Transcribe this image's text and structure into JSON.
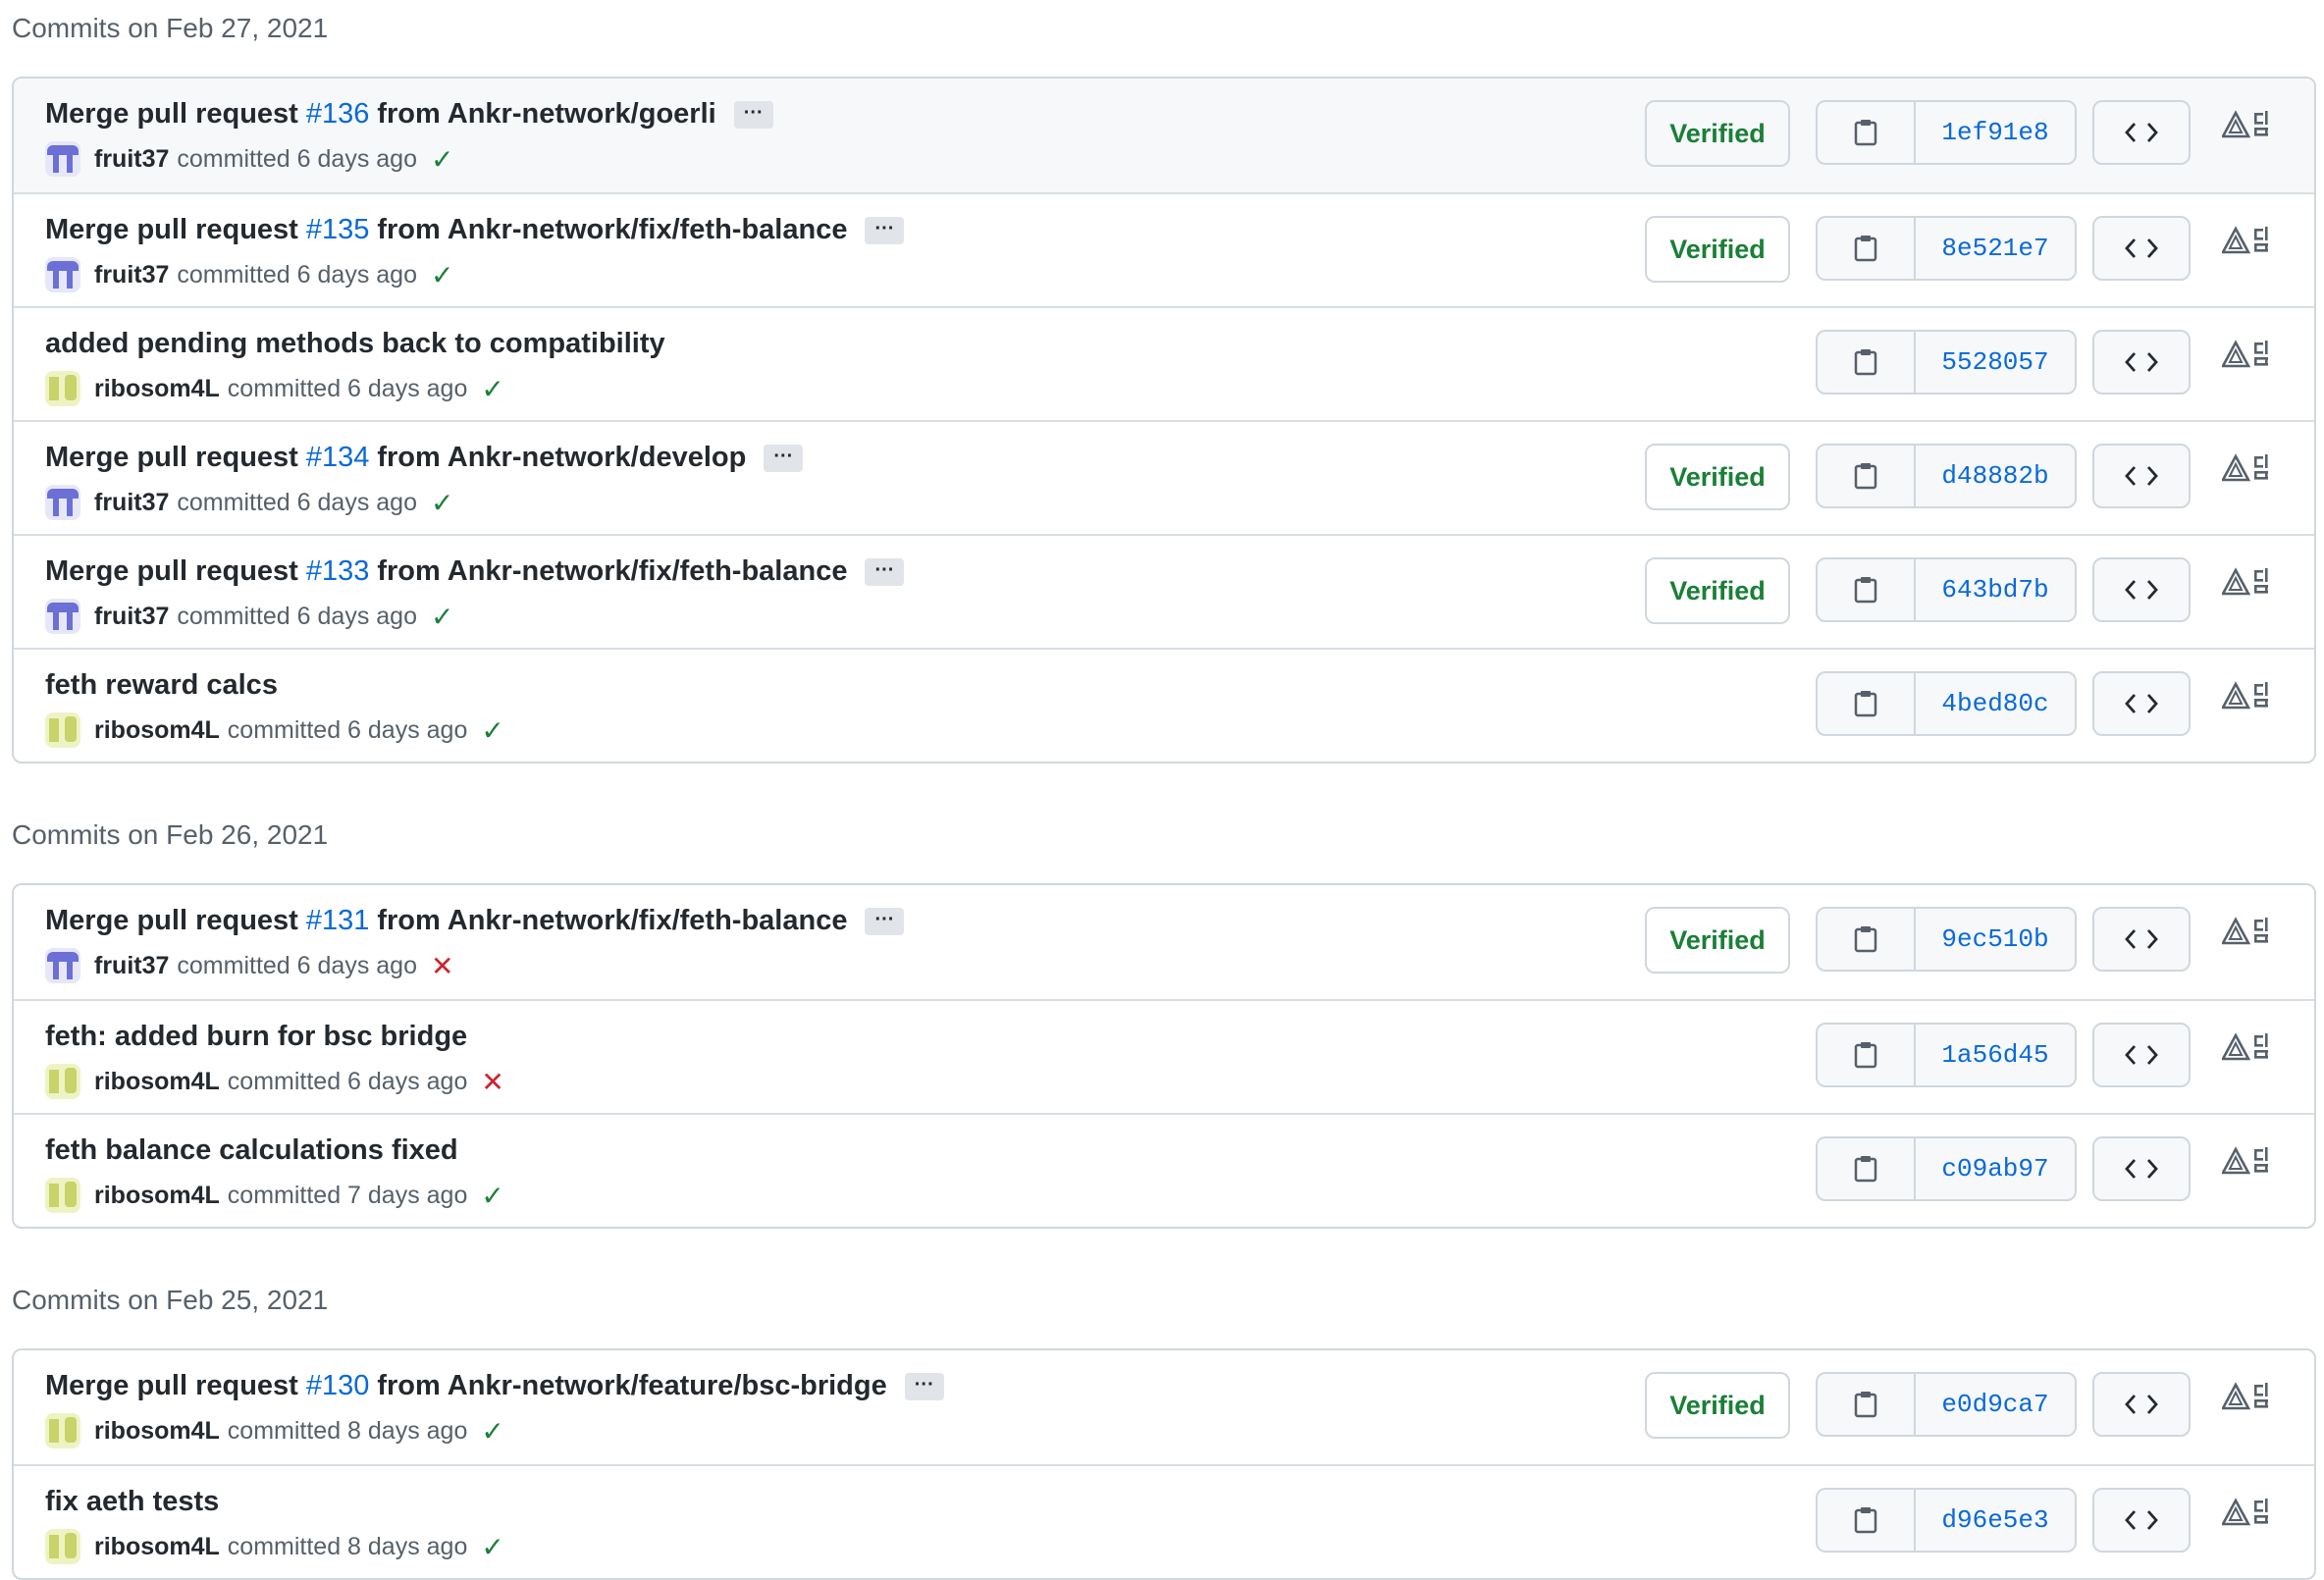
{
  "colors": {
    "verified": "#1a7f37",
    "link": "#0969da",
    "fail": "#cf222e",
    "border": "#d0d7de"
  },
  "icons": {
    "copy": "clipboard-icon",
    "browse": "code-icon",
    "status_ok": "check-icon",
    "status_fail": "x-icon",
    "extension": "ankr-extension-icon"
  },
  "groups": [
    {
      "title": "Commits on Feb 27, 2021",
      "commits": [
        {
          "pre": "Merge pull request ",
          "pr": "#136",
          "post": " from Ankr-network/goerli",
          "author": "fruit37",
          "avatar": "fruit",
          "when": "committed 6 days ago",
          "status": "ok",
          "verified": "Verified",
          "sha": "1ef91e8",
          "ellipsis": "···",
          "hover": true
        },
        {
          "pre": "Merge pull request ",
          "pr": "#135",
          "post": " from Ankr-network/fix/feth-balance",
          "author": "fruit37",
          "avatar": "fruit",
          "when": "committed 6 days ago",
          "status": "ok",
          "verified": "Verified",
          "sha": "8e521e7",
          "ellipsis": "···"
        },
        {
          "pre": "added pending methods back to compatibility",
          "pr": "",
          "post": "",
          "author": "ribosom4L",
          "avatar": "ribo",
          "when": "committed 6 days ago",
          "status": "ok",
          "verified": "",
          "sha": "5528057",
          "ellipsis": ""
        },
        {
          "pre": "Merge pull request ",
          "pr": "#134",
          "post": " from Ankr-network/develop",
          "author": "fruit37",
          "avatar": "fruit",
          "when": "committed 6 days ago",
          "status": "ok",
          "verified": "Verified",
          "sha": "d48882b",
          "ellipsis": "···"
        },
        {
          "pre": "Merge pull request ",
          "pr": "#133",
          "post": " from Ankr-network/fix/feth-balance",
          "author": "fruit37",
          "avatar": "fruit",
          "when": "committed 6 days ago",
          "status": "ok",
          "verified": "Verified",
          "sha": "643bd7b",
          "ellipsis": "···"
        },
        {
          "pre": "feth reward calcs",
          "pr": "",
          "post": "",
          "author": "ribosom4L",
          "avatar": "ribo",
          "when": "committed 6 days ago",
          "status": "ok",
          "verified": "",
          "sha": "4bed80c",
          "ellipsis": ""
        }
      ]
    },
    {
      "title": "Commits on Feb 26, 2021",
      "commits": [
        {
          "pre": "Merge pull request ",
          "pr": "#131",
          "post": " from Ankr-network/fix/feth-balance",
          "author": "fruit37",
          "avatar": "fruit",
          "when": "committed 6 days ago",
          "status": "fail",
          "verified": "Verified",
          "sha": "9ec510b",
          "ellipsis": "···"
        },
        {
          "pre": "feth: added burn for bsc bridge",
          "pr": "",
          "post": "",
          "author": "ribosom4L",
          "avatar": "ribo",
          "when": "committed 6 days ago",
          "status": "fail",
          "verified": "",
          "sha": "1a56d45",
          "ellipsis": ""
        },
        {
          "pre": "feth balance calculations fixed",
          "pr": "",
          "post": "",
          "author": "ribosom4L",
          "avatar": "ribo",
          "when": "committed 7 days ago",
          "status": "ok",
          "verified": "",
          "sha": "c09ab97",
          "ellipsis": ""
        }
      ]
    },
    {
      "title": "Commits on Feb 25, 2021",
      "commits": [
        {
          "pre": "Merge pull request ",
          "pr": "#130",
          "post": " from Ankr-network/feature/bsc-bridge",
          "author": "ribosom4L",
          "avatar": "ribo",
          "when": "committed 8 days ago",
          "status": "ok",
          "verified": "Verified",
          "sha": "e0d9ca7",
          "ellipsis": "···"
        },
        {
          "pre": "fix aeth tests",
          "pr": "",
          "post": "",
          "author": "ribosom4L",
          "avatar": "ribo",
          "when": "committed 8 days ago",
          "status": "ok",
          "verified": "",
          "sha": "d96e5e3",
          "ellipsis": ""
        }
      ]
    }
  ]
}
